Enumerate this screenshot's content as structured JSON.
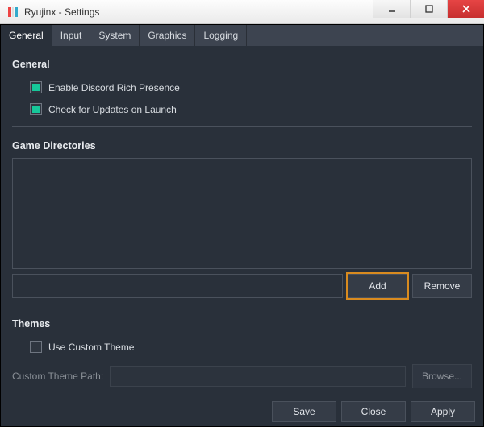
{
  "window": {
    "title": "Ryujinx - Settings"
  },
  "tabs": [
    {
      "label": "General",
      "active": true
    },
    {
      "label": "Input"
    },
    {
      "label": "System"
    },
    {
      "label": "Graphics"
    },
    {
      "label": "Logging"
    }
  ],
  "general": {
    "heading": "General",
    "discord_label": "Enable Discord Rich Presence",
    "discord_checked": true,
    "updates_label": "Check for Updates on Launch",
    "updates_checked": true
  },
  "game_dirs": {
    "heading": "Game Directories",
    "items": [],
    "input_value": "",
    "add_label": "Add",
    "remove_label": "Remove"
  },
  "themes": {
    "heading": "Themes",
    "use_custom_label": "Use Custom Theme",
    "use_custom_checked": false,
    "path_label": "Custom Theme Path:",
    "path_value": "",
    "browse_label": "Browse..."
  },
  "footer": {
    "save_label": "Save",
    "close_label": "Close",
    "apply_label": "Apply"
  }
}
